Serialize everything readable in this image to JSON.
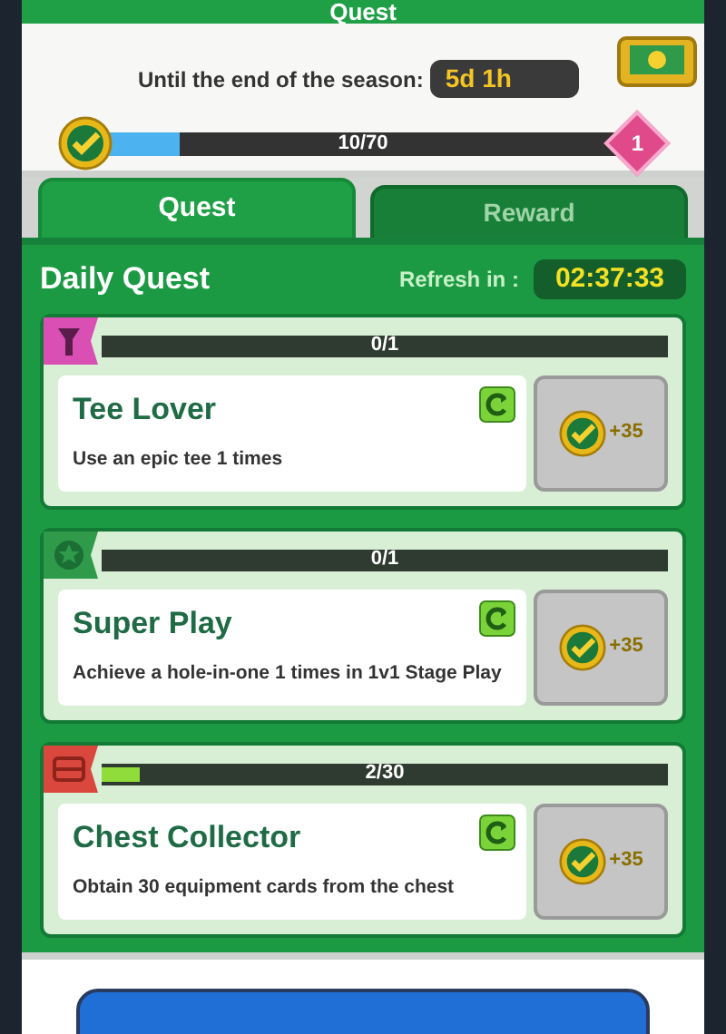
{
  "title": "Quest",
  "season": {
    "label": "Until the end of the season:",
    "time": "5d 1h",
    "progress": "10/70",
    "level": 0.143,
    "tier": "1"
  },
  "tabs": [
    {
      "label": "Quest",
      "selected": true
    },
    {
      "label": "Reward",
      "selected": false
    }
  ],
  "daily": {
    "title": "Daily Quest",
    "refresh_label": "Refresh in :",
    "refresh_time": "02:37:33"
  },
  "quests": [
    {
      "kind": "tee",
      "color": "#d94fb4",
      "progress": "0/1",
      "title": "Tee Lover",
      "description": "Use an epic tee 1 times",
      "reward": "+35"
    },
    {
      "kind": "star",
      "color": "#2e9a4a",
      "progress": "0/1",
      "title": "Super Play",
      "description": "Achieve a hole-in-one 1 times in 1v1 Stage Play",
      "reward": "+35"
    },
    {
      "kind": "chest",
      "color": "#d9473d",
      "progress": "2/30",
      "level": 0.067,
      "title": "Chest Collector",
      "description": "Obtain 30 equipment cards from the chest",
      "reward": "+35"
    }
  ]
}
